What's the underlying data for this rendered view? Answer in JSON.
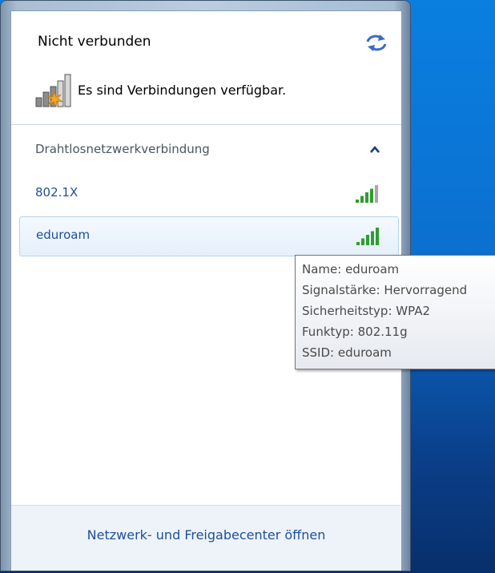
{
  "status": {
    "title": "Nicht verbunden",
    "available_text": "Es sind Verbindungen verfügbar."
  },
  "section": {
    "label": "Drahtlosnetzwerkverbindung",
    "collapse_icon": "chevron-up-icon"
  },
  "networks": [
    {
      "name": "802.1X",
      "signal_bars": 4,
      "signal_max": 5
    },
    {
      "name": "eduroam",
      "signal_bars": 5,
      "signal_max": 5,
      "hovered": true
    }
  ],
  "tooltip": {
    "lines": [
      "Name: eduroam",
      "Signalstärke: Hervorragend",
      "Sicherheitstyp: WPA2",
      "Funktyp: 802.11g",
      "SSID: eduroam"
    ]
  },
  "footer": {
    "link_label": "Netzwerk- und Freigabecenter öffnen"
  },
  "colors": {
    "link": "#1d4f9e",
    "signal_on": "#2e9e2e",
    "signal_off": "#a7a7a7",
    "warning": "#f5a623"
  }
}
